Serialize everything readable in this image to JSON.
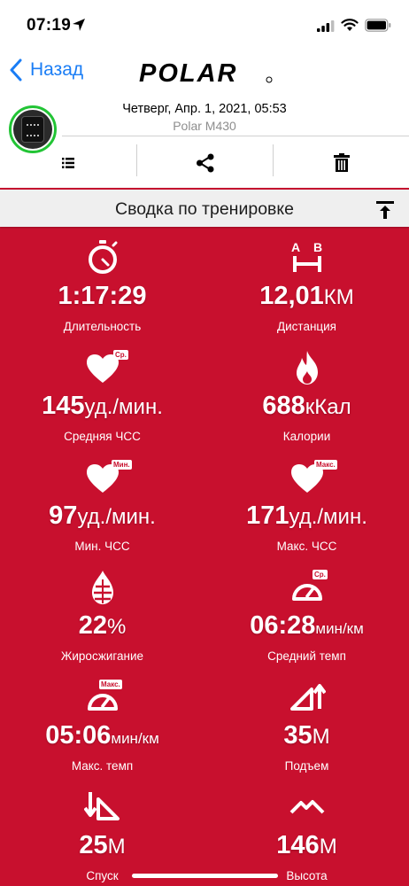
{
  "status_bar": {
    "time": "07:19"
  },
  "nav": {
    "back_label": "Назад",
    "logo_text": "POLAR"
  },
  "session": {
    "date": "Четверг, Апр. 1, 2021, 05:53",
    "device": "Polar M430"
  },
  "toolbar": {
    "icons": [
      "list-icon",
      "share-icon",
      "trash-icon"
    ]
  },
  "section": {
    "title": "Сводка по тренировке"
  },
  "stats": [
    {
      "value": "1:17:29",
      "unit": "",
      "label": "Длительность",
      "icon": "stopwatch-icon"
    },
    {
      "value": "12,01",
      "unit": "КМ",
      "label": "Дистанция",
      "icon": "distance-ab-icon",
      "icon_text_a": "A",
      "icon_text_b": "B"
    },
    {
      "value": "145",
      "unit": "уд./мин.",
      "label": "Средняя ЧСС",
      "icon": "heart-avg-icon",
      "badge": "Ср."
    },
    {
      "value": "688",
      "unit": "кКал",
      "label": "Калории",
      "icon": "flame-icon"
    },
    {
      "value": "97",
      "unit": "уд./мин.",
      "label": "Мин. ЧСС",
      "icon": "heart-min-icon",
      "badge": "Мин."
    },
    {
      "value": "171",
      "unit": "уд./мин.",
      "label": "Макс. ЧСС",
      "icon": "heart-max-icon",
      "badge": "Макс."
    },
    {
      "value": "22",
      "unit": "%",
      "label": "Жиросжигание",
      "icon": "fat-burn-icon"
    },
    {
      "value": "06:28",
      "unit": "мин/км",
      "label": "Средний темп",
      "icon": "pace-avg-icon",
      "badge": "Ср."
    },
    {
      "value": "05:06",
      "unit": "мин/км",
      "label": "Макс. темп",
      "icon": "pace-max-icon",
      "badge": "Макс."
    },
    {
      "value": "35",
      "unit": "М",
      "label": "Подъем",
      "icon": "ascent-icon"
    },
    {
      "value": "25",
      "unit": "М",
      "label": "Спуск",
      "icon": "descent-icon"
    },
    {
      "value": "146",
      "unit": "М",
      "label": "Высота",
      "icon": "altitude-icon"
    }
  ],
  "colors": {
    "brand_red": "#c8102e",
    "link_blue": "#1a7df5",
    "device_ring": "#22c435"
  }
}
